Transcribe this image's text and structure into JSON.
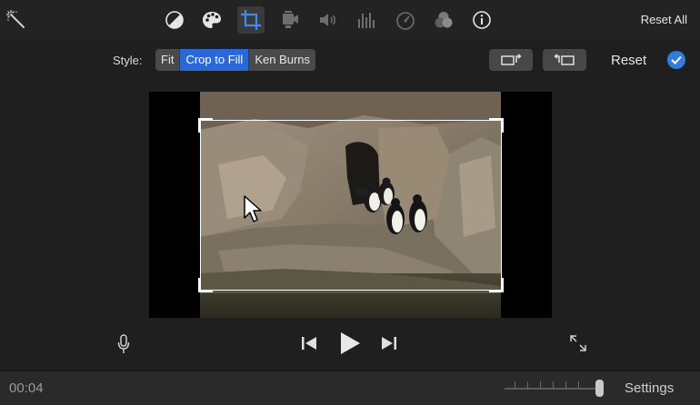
{
  "toolbar": {
    "tools": [
      {
        "name": "magic-wand-icon"
      },
      {
        "name": "color-balance-icon"
      },
      {
        "name": "color-palette-icon"
      },
      {
        "name": "crop-icon",
        "active": true
      },
      {
        "name": "stabilization-camera-icon"
      },
      {
        "name": "volume-icon"
      },
      {
        "name": "equalizer-icon"
      },
      {
        "name": "speed-gauge-icon"
      },
      {
        "name": "video-overlay-icon"
      },
      {
        "name": "info-icon"
      }
    ],
    "reset_all_label": "Reset All"
  },
  "style_row": {
    "style_label": "Style:",
    "options": [
      "Fit",
      "Crop to Fill",
      "Ken Burns"
    ],
    "selected": "Crop to Fill",
    "reset_label": "Reset"
  },
  "viewer": {
    "crop_active": true
  },
  "bottom_bar": {
    "timecode": "00:04",
    "settings_label": "Settings"
  },
  "colors": {
    "accent": "#2b67d6",
    "check": "#2f7de1",
    "background": "#1f1f1f"
  }
}
